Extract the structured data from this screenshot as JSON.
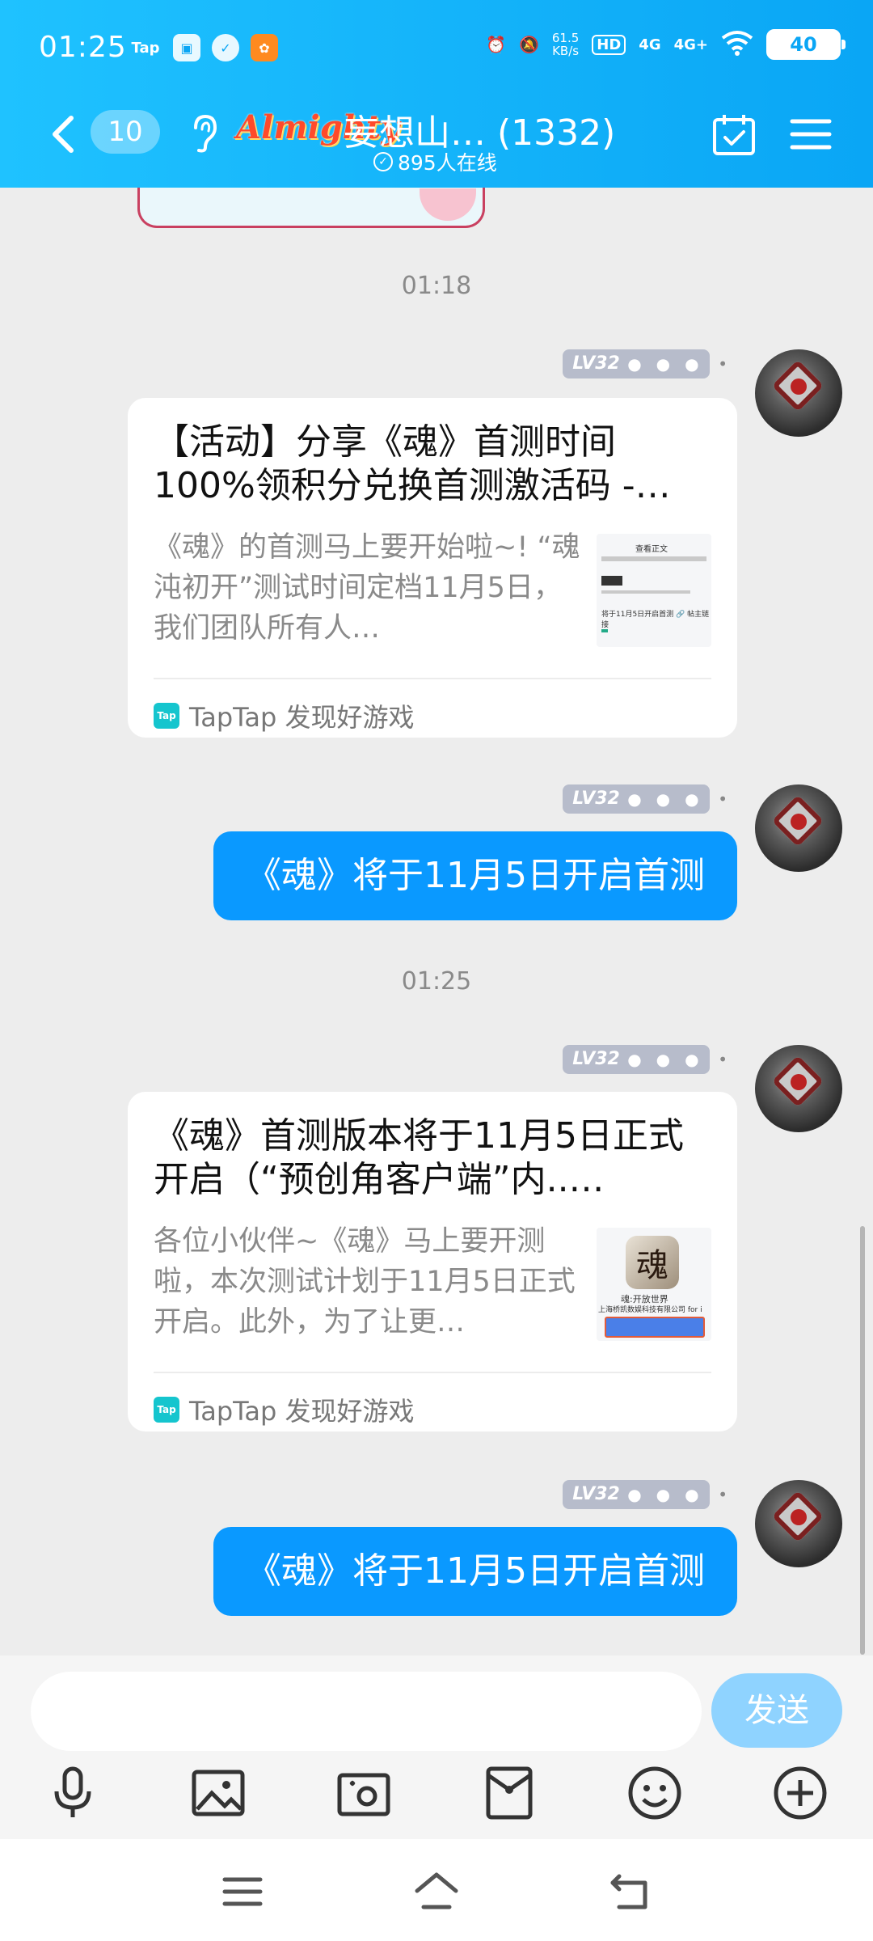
{
  "status_bar": {
    "time": "01:25",
    "tap_label": "Tap",
    "net_speed_value": "61.5",
    "net_speed_unit": "KB/s",
    "hd_label": "HD",
    "signal1": "4G",
    "signal2": "4G+",
    "battery": "40"
  },
  "header": {
    "unread_count": "10",
    "brand_logo_text": "Almighty",
    "group_name": "妄想山…",
    "member_count": "(1332)",
    "online_text": "895人在线"
  },
  "chat": {
    "messages": [
      {
        "timestamp": "01:18",
        "level": "LV32",
        "card_title": "【活动】分享《魂》首测时间100%领积分兑换首测激活码 -…",
        "card_desc": "《魂》的首测马上要开始啦~! “魂沌初开”测试时间定档11月5日，我们团队所有人…",
        "thumb_title": "查看正文",
        "thumb_link": "将于11月5日开启首测 🔗 帖主链接",
        "card_source": "TapTap 发现好游戏"
      },
      {
        "level": "LV32",
        "text": "《魂》将于11月5日开启首测"
      },
      {
        "timestamp": "01:25",
        "level": "LV32",
        "card_title": "《魂》首测版本将于11月5日正式开启（“预创角客户端”内..…",
        "card_desc": "各位小伙伴~《魂》马上要开测啦，本次测试计划于11月5日正式开启。此外，为了让更…",
        "thumb_app_name": "魂:开放世界",
        "thumb_app_company": "上海桥凯数娱科技有限公司 for i",
        "card_source": "TapTap 发现好游戏"
      },
      {
        "level": "LV32",
        "text": "《魂》将于11月5日开启首测"
      }
    ]
  },
  "input": {
    "value": "",
    "placeholder": "",
    "send_label": "发送"
  },
  "colors": {
    "header_start": "#1fc2ff",
    "header_end": "#0aa6f5",
    "bubble": "#0a99ff",
    "send_button": "#8fd3ff",
    "level_badge": "#b7bccb"
  },
  "icons": {
    "back": "chevron-left-icon",
    "ear": "ear-icon",
    "calendar": "calendar-check-icon",
    "menu": "menu-icon",
    "tools": [
      "microphone-icon",
      "image-icon",
      "camera-icon",
      "red-packet-icon",
      "emoji-icon",
      "plus-icon"
    ],
    "system": [
      "recent-apps-icon",
      "home-icon",
      "back-icon"
    ]
  }
}
